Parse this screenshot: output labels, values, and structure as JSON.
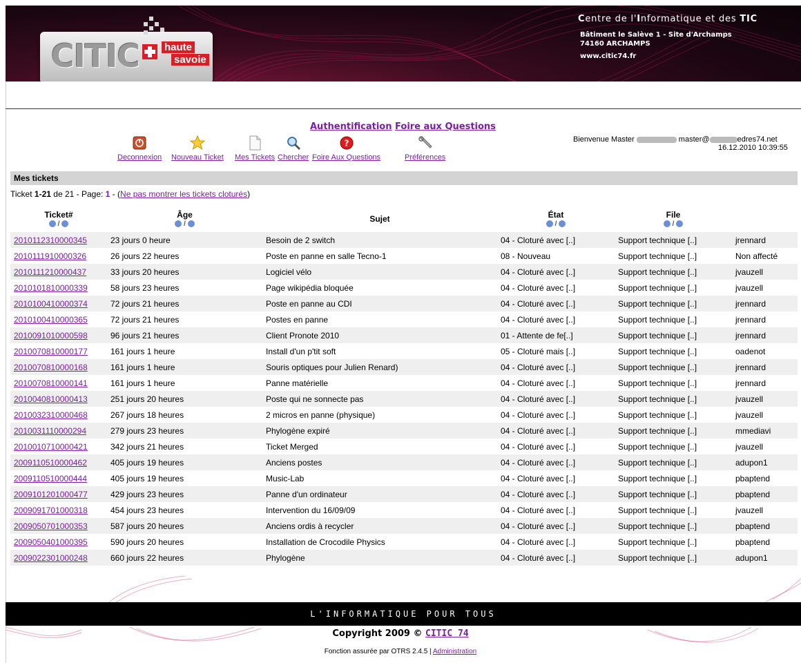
{
  "header": {
    "logo": {
      "word": "CITIC",
      "haute": "haute",
      "savoie": "savoie"
    },
    "org_title_prefix_1": "C",
    "org_title_part_1": "entre de l'",
    "org_title_prefix_2": "I",
    "org_title_part_2": "nformatique et des ",
    "org_title_tic": "TIC",
    "address_line_1": "Bâtiment le Salève 1 - Site d'Archamps",
    "address_line_2": "74160 ARCHAMPS",
    "website": "www.citic74.fr"
  },
  "top_links": {
    "auth": "Authentification",
    "faq": "Foire aux Questions"
  },
  "toolbar": [
    {
      "label": "Deconnexion",
      "icon": "power-icon"
    },
    {
      "label": "Nouveau Ticket",
      "icon": "star-icon"
    },
    {
      "label": "Mes Tickets",
      "icon": "document-icon"
    },
    {
      "label": "Chercher",
      "icon": "magnifier-icon"
    },
    {
      "label": "Foire Aux Questions",
      "icon": "help-icon"
    },
    {
      "label": "Préférences",
      "icon": "wrench-icon"
    }
  ],
  "user": {
    "welcome_prefix": "Bienvenue Master",
    "email_prefix": "master@",
    "email_suffix": "edres74.net",
    "datetime": "16.12.2010 10:39:55"
  },
  "section_title": "Mes tickets",
  "pager": {
    "prefix": "Ticket ",
    "range": "1-21",
    "of": " de 21 - Page: ",
    "page": "1",
    "sep": " - (",
    "hide_closed_link": "Ne pas montrer les tickets cloturés",
    "close": ")"
  },
  "table": {
    "columns": {
      "ticket": "Ticket#",
      "age": "Âge",
      "subject": "Sujet",
      "state": "État",
      "queue": "File",
      "sort_sep": "/"
    },
    "rows": [
      [
        "2010112310000345",
        "23 jours 0 heure",
        "Besoin de 2 switch",
        "04 - Cloturé avec [..]",
        "Support technique [..]",
        "jrennard"
      ],
      [
        "2010111910000326",
        "26 jours 22 heures",
        "Poste en panne en salle Tecno-1",
        "08 - Nouveau",
        "Support technique [..]",
        "Non affecté"
      ],
      [
        "2010111210000437",
        "33 jours 20 heures",
        "Logiciel vélo",
        "04 - Cloturé avec [..]",
        "Support technique [..]",
        "jvauzell"
      ],
      [
        "2010101810000339",
        "58 jours 23 heures",
        "Page wikipédia bloquée",
        "04 - Cloturé avec [..]",
        "Support technique [..]",
        "jvauzell"
      ],
      [
        "2010100410000374",
        "72 jours 21 heures",
        "Poste en panne au CDI",
        "04 - Cloturé avec [..]",
        "Support technique [..]",
        "jrennard"
      ],
      [
        "2010100410000365",
        "72 jours 21 heures",
        "Postes en panne",
        "04 - Cloturé avec [..]",
        "Support technique [..]",
        "jrennard"
      ],
      [
        "2010091010000598",
        "96 jours 21 heures",
        "Client Pronote 2010",
        "01 - Attente de fe[..]",
        "Support technique [..]",
        "jrennard"
      ],
      [
        "2010070810000177",
        "161 jours 1 heure",
        "Install d'un p'tit soft",
        "05 - Cloturé mais [..]",
        "Support technique [..]",
        "oadenot"
      ],
      [
        "2010070810000168",
        "161 jours 1 heure",
        "Souris optiques pour Julien Renard)",
        "04 - Cloturé avec [..]",
        "Support technique [..]",
        "jrennard"
      ],
      [
        "2010070810000141",
        "161 jours 1 heure",
        "Panne matérielle",
        "04 - Cloturé avec [..]",
        "Support technique [..]",
        "jrennard"
      ],
      [
        "2010040810000413",
        "251 jours 20 heures",
        "Poste qui ne sonnecte pas",
        "04 - Cloturé avec [..]",
        "Support technique [..]",
        "jvauzell"
      ],
      [
        "2010032310000468",
        "267 jours 18 heures",
        "2 micros en panne (physique)",
        "04 - Cloturé avec [..]",
        "Support technique [..]",
        "jvauzell"
      ],
      [
        "2010031110000294",
        "279 jours 23 heures",
        "Phylogène expiré",
        "04 - Cloturé avec [..]",
        "Support technique [..]",
        "mmediavi"
      ],
      [
        "2010010710000421",
        "342 jours 21 heures",
        "Ticket Merged",
        "04 - Cloturé avec [..]",
        "Support technique [..]",
        "jvauzell"
      ],
      [
        "2009110510000462",
        "405 jours 19 heures",
        "Anciens postes",
        "04 - Cloturé avec [..]",
        "Support technique [..]",
        "adupon1"
      ],
      [
        "2009110510000444",
        "405 jours 19 heures",
        "Music-Lab",
        "04 - Cloturé avec [..]",
        "Support technique [..]",
        "pbaptend"
      ],
      [
        "2009101201000477",
        "429 jours 23 heures",
        "Panne d'un ordinateur",
        "04 - Cloturé avec [..]",
        "Support technique [..]",
        "pbaptend"
      ],
      [
        "2009091701000318",
        "454 jours 23 heures",
        "Intervention du 16/09/09",
        "04 - Cloturé avec [..]",
        "Support technique [..]",
        "jvauzell"
      ],
      [
        "2009050701000353",
        "587 jours 20 heures",
        "Anciens ordis à recycler",
        "04 - Cloturé avec [..]",
        "Support technique [..]",
        "pbaptend"
      ],
      [
        "2009050401000395",
        "590 jours 20 heures",
        "Installation de Crocodile Physics",
        "04 - Cloturé avec [..]",
        "Support technique [..]",
        "pbaptend"
      ],
      [
        "2009022301000248",
        "660 jours 22 heures",
        "Phylogène",
        "04 - Cloturé avec [..]",
        "Support technique [..]",
        "adupon1"
      ]
    ]
  },
  "footer": {
    "slogan": "L'INFORMATIQUE POUR TOUS",
    "copyright_prefix": "Copyright 2009 © ",
    "copyright_link": "CITIC 74",
    "powered": "Fonction assurée par OTRS 2.4.5 | ",
    "admin_link": "Administration"
  },
  "colors": {
    "link": "#7b1fa2",
    "banner": "#2a0814",
    "row_alt": "#efefef",
    "section_bg": "#d4d4d4"
  }
}
